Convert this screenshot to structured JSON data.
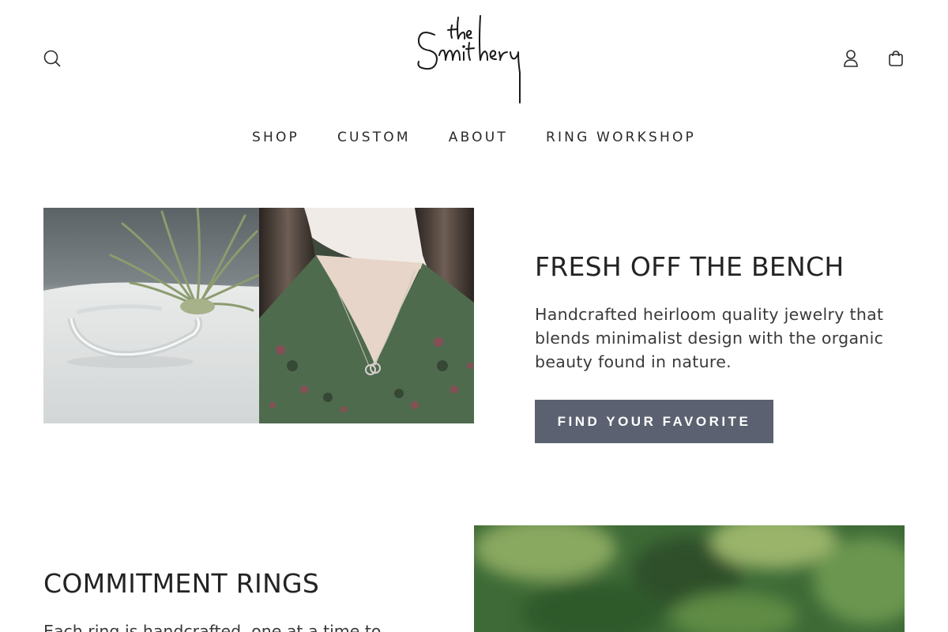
{
  "brand": {
    "logo_text_small": "the",
    "logo_text_main": "Smithery"
  },
  "header": {
    "icons": {
      "search": "search-icon",
      "account": "account-icon",
      "cart": "shopping-bag-icon"
    }
  },
  "nav": {
    "items": [
      {
        "label": "SHOP"
      },
      {
        "label": "CUSTOM"
      },
      {
        "label": "ABOUT"
      },
      {
        "label": "RING WORKSHOP"
      }
    ]
  },
  "hero": {
    "title": "FRESH OFF THE BENCH",
    "description": "Handcrafted heirloom quality jewelry that blends minimalist design with the organic beauty found in nature.",
    "button_label": "FIND YOUR FAVORITE",
    "button_color": "#5b6170"
  },
  "section2": {
    "title": "COMMITMENT RINGS",
    "description": "Each ring is handcrafted, one at a time to"
  }
}
